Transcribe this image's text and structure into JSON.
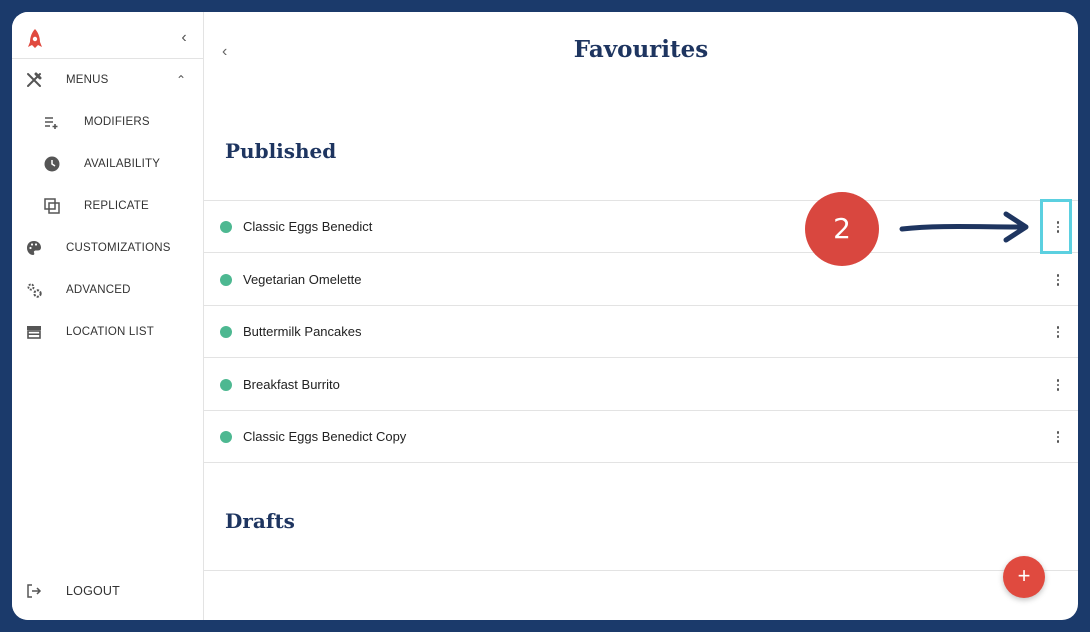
{
  "sidebar": {
    "collapse_icon": "chevron-left-icon",
    "items": [
      {
        "label": "MENUS",
        "icon": "utensils-icon"
      },
      {
        "label": "MODIFIERS",
        "icon": "list-add-icon"
      },
      {
        "label": "AVAILABILITY",
        "icon": "clock-icon"
      },
      {
        "label": "REPLICATE",
        "icon": "copy-icon"
      },
      {
        "label": "CUSTOMIZATIONS",
        "icon": "palette-icon"
      },
      {
        "label": "ADVANCED",
        "icon": "gears-icon"
      },
      {
        "label": "LOCATION LIST",
        "icon": "store-icon"
      }
    ],
    "logout_label": "LOGOUT"
  },
  "main": {
    "title": "Favourites",
    "published_heading": "Published",
    "drafts_heading": "Drafts",
    "published_items": [
      {
        "name": "Classic Eggs Benedict",
        "status": "published"
      },
      {
        "name": "Vegetarian Omelette",
        "status": "published"
      },
      {
        "name": "Buttermilk Pancakes",
        "status": "published"
      },
      {
        "name": "Breakfast Burrito",
        "status": "published"
      },
      {
        "name": "Classic Eggs Benedict Copy",
        "status": "published"
      }
    ],
    "fab_label": "+"
  },
  "annotation": {
    "step_number": "2"
  },
  "colors": {
    "frame_border": "#1b3a6b",
    "heading": "#1e3560",
    "status_published": "#4db891",
    "accent_red": "#d9473f",
    "highlight": "#5bd0e0"
  }
}
